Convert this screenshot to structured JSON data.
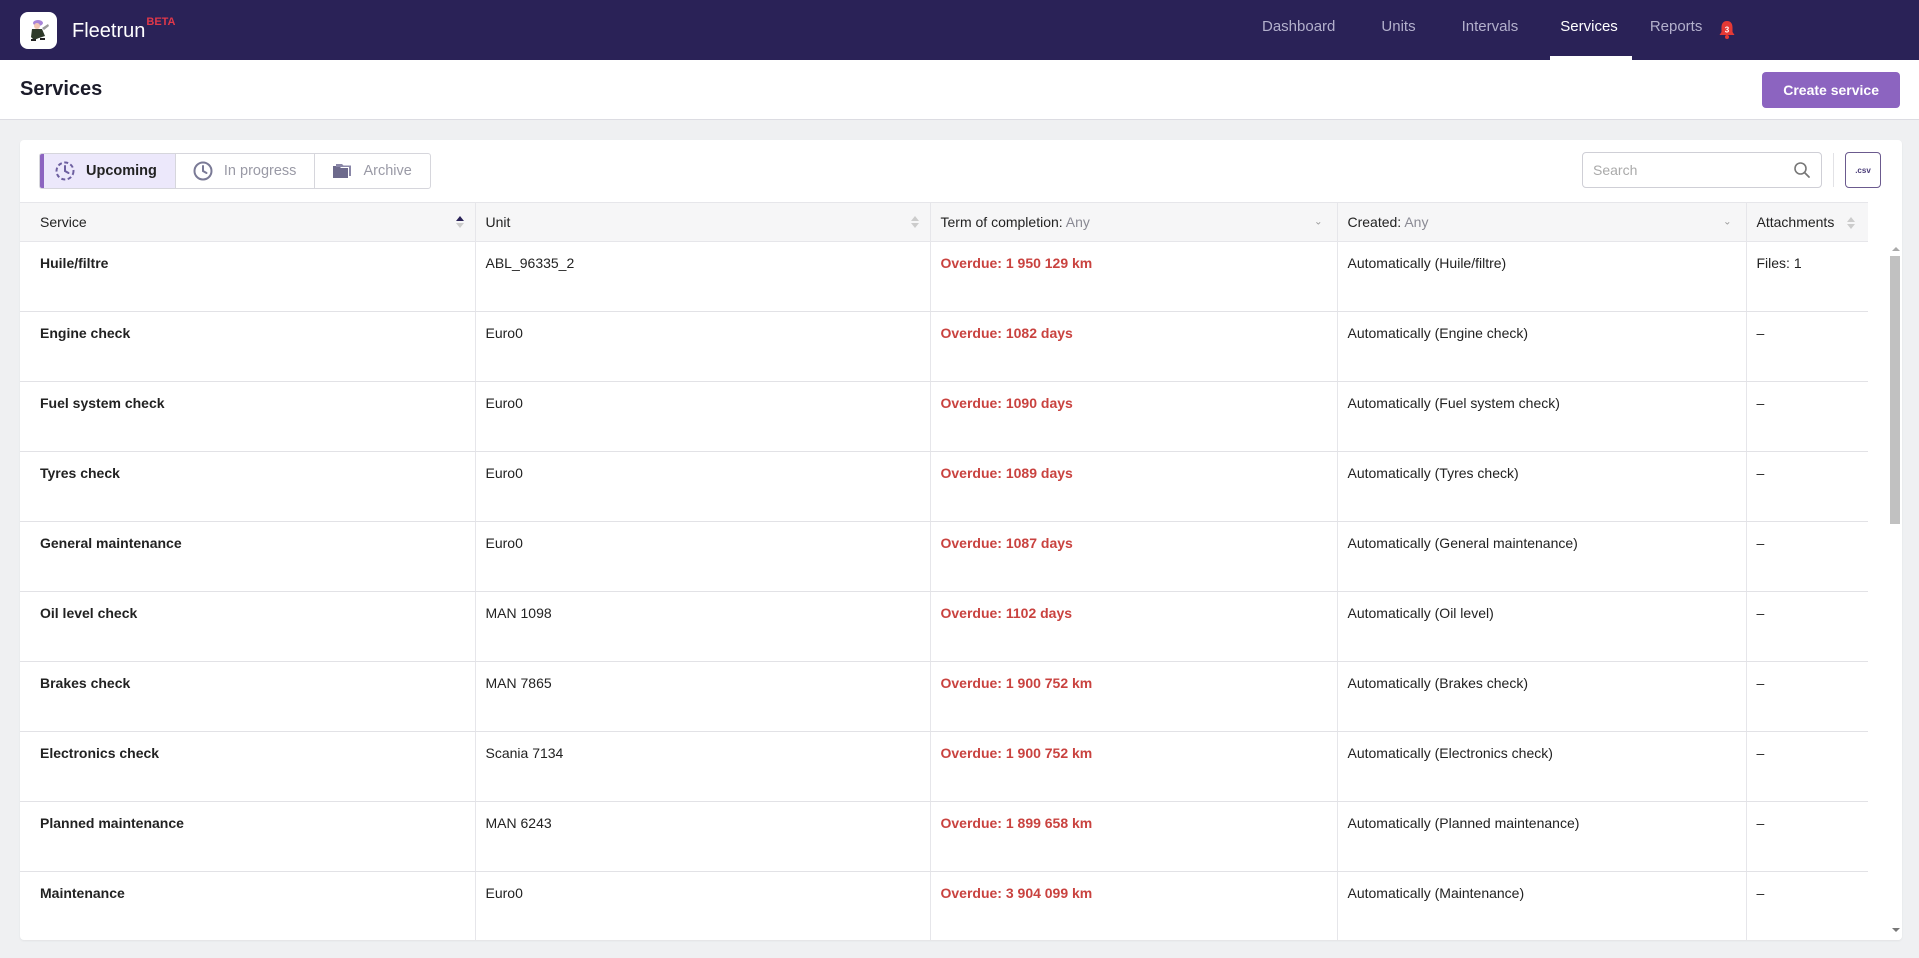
{
  "app": {
    "name": "Fleetrun",
    "badge": "BETA",
    "logo_icon": "mechanic-logo-icon",
    "nav": [
      {
        "label": "Dashboard",
        "active": false
      },
      {
        "label": "Units",
        "active": false
      },
      {
        "label": "Intervals",
        "active": false
      },
      {
        "label": "Services",
        "active": true
      },
      {
        "label": "Reports",
        "active": false
      }
    ],
    "notifications": {
      "icon": "bell-icon",
      "count": "3"
    }
  },
  "page": {
    "title": "Services",
    "create_label": "Create service"
  },
  "toolbar": {
    "tabs": [
      {
        "label": "Upcoming",
        "icon": "upcoming-clock-icon",
        "active": true
      },
      {
        "label": "In progress",
        "icon": "clock-icon",
        "active": false
      },
      {
        "label": "Archive",
        "icon": "folder-icon",
        "active": false
      }
    ],
    "search_placeholder": "Search",
    "search_value": "",
    "csv_label": ".csv"
  },
  "table": {
    "columns": {
      "service": "Service",
      "unit": "Unit",
      "term_label": "Term of completion:",
      "term_value": "Any",
      "created_label": "Created:",
      "created_value": "Any",
      "attachments": "Attachments"
    },
    "sort": {
      "column": "service",
      "direction": "asc"
    },
    "rows": [
      {
        "service": "Huile/filtre",
        "unit": "ABL_96335_2",
        "term": "Overdue: 1 950 129 km",
        "created": "Automatically (Huile/filtre)",
        "attachments": "Files: 1"
      },
      {
        "service": "Engine check",
        "unit": "Euro0",
        "term": "Overdue: 1082 days",
        "created": "Automatically (Engine check)",
        "attachments": "–"
      },
      {
        "service": "Fuel system check",
        "unit": "Euro0",
        "term": "Overdue: 1090 days",
        "created": "Automatically (Fuel system check)",
        "attachments": "–"
      },
      {
        "service": "Tyres check",
        "unit": "Euro0",
        "term": "Overdue: 1089 days",
        "created": "Automatically (Tyres check)",
        "attachments": "–"
      },
      {
        "service": "General maintenance",
        "unit": "Euro0",
        "term": "Overdue: 1087 days",
        "created": "Automatically (General maintenance)",
        "attachments": "–"
      },
      {
        "service": "Oil level check",
        "unit": "MAN 1098",
        "term": "Overdue: 1102 days",
        "created": "Automatically (Oil level)",
        "attachments": "–"
      },
      {
        "service": "Brakes check",
        "unit": "MAN 7865",
        "term": "Overdue: 1 900 752 km",
        "created": "Automatically (Brakes check)",
        "attachments": "–"
      },
      {
        "service": "Electronics check",
        "unit": "Scania 7134",
        "term": "Overdue: 1 900 752 km",
        "created": "Automatically (Electronics check)",
        "attachments": "–"
      },
      {
        "service": "Planned maintenance",
        "unit": "MAN 6243",
        "term": "Overdue: 1 899 658 km",
        "created": "Automatically (Planned maintenance)",
        "attachments": "–"
      },
      {
        "service": "Maintenance",
        "unit": "Euro0",
        "term": "Overdue: 3 904 099 km",
        "created": "Automatically (Maintenance)",
        "attachments": "–"
      }
    ]
  },
  "colors": {
    "topbar": "#2a2257",
    "accent": "#8c64c0",
    "overdue": "#c9423f",
    "beta": "#e0384a"
  }
}
